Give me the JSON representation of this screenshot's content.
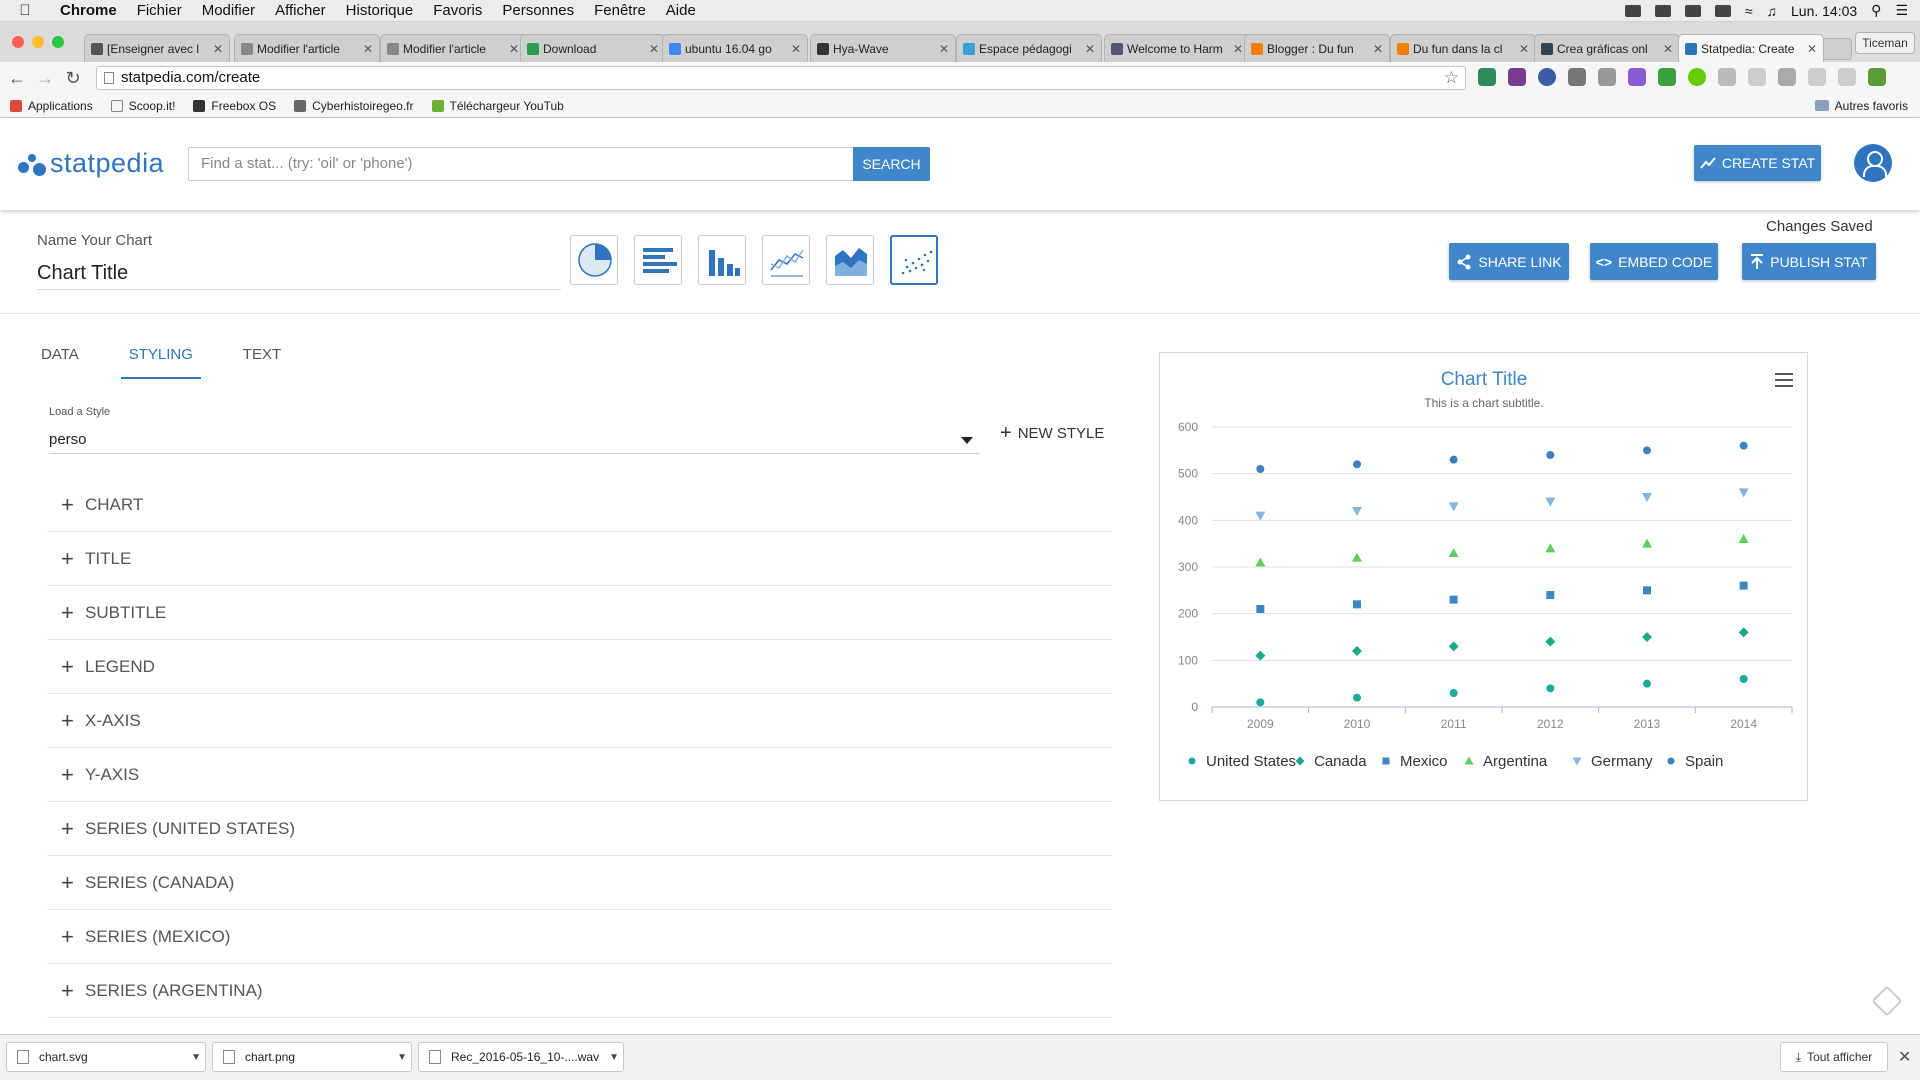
{
  "menubar": {
    "app": "Chrome",
    "items": [
      "Fichier",
      "Modifier",
      "Afficher",
      "Historique",
      "Favoris",
      "Personnes",
      "Fenêtre",
      "Aide"
    ],
    "clock": "Lun. 14:03"
  },
  "browser": {
    "tabs": [
      {
        "label": "[Enseigner avec l",
        "favicon_color": "#555555"
      },
      {
        "label": "Modifier l'article",
        "favicon_color": "#888888"
      },
      {
        "label": "Modifier l'article",
        "favicon_color": "#888888"
      },
      {
        "label": "Download",
        "favicon_color": "#2e9d4f"
      },
      {
        "label": "ubuntu 16.04 go",
        "favicon_color": "#4285f4"
      },
      {
        "label": "Hya-Wave",
        "favicon_color": "#333333"
      },
      {
        "label": "Espace pédagogi",
        "favicon_color": "#3aa0d8"
      },
      {
        "label": "Welcome to Harm",
        "favicon_color": "#555577"
      },
      {
        "label": "Blogger : Du fun",
        "favicon_color": "#f57d00"
      },
      {
        "label": "Du fun dans la cl",
        "favicon_color": "#f57d00"
      },
      {
        "label": "Crea gráficas onl",
        "favicon_color": "#334455"
      },
      {
        "label": "Statpedia: Create",
        "favicon_color": "#2f74c0"
      }
    ],
    "profile": "Ticeman",
    "url": "statpedia.com/create",
    "bookmarks": [
      {
        "label": "Applications",
        "icon": "apps-grid-icon",
        "color": "#d64d3c"
      },
      {
        "label": "Scoop.it!",
        "icon": "page-icon",
        "color": "#888888"
      },
      {
        "label": "Freebox OS",
        "icon": "freebox-icon",
        "color": "#333333"
      },
      {
        "label": "Cyberhistoiregeo.fr",
        "icon": "owl-icon",
        "color": "#666666"
      },
      {
        "label": "Téléchargeur YouTub",
        "icon": "download-icon",
        "color": "#6bb02e"
      }
    ],
    "other_bookmarks": "Autres favoris"
  },
  "site": {
    "logo": "statpedia",
    "search_placeholder": "Find a stat... (try: 'oil' or 'phone')",
    "search_button": "SEARCH",
    "create_stat": "CREATE STAT"
  },
  "editor": {
    "name_label": "Name Your Chart",
    "chart_name": "Chart Title",
    "changes_saved": "Changes Saved",
    "share_link": "SHARE LINK",
    "embed_code": "EMBED CODE",
    "publish_stat": "PUBLISH STAT",
    "tabs": [
      "DATA",
      "STYLING",
      "TEXT"
    ],
    "active_tab": "STYLING",
    "load_style_label": "Load a Style",
    "load_style_value": "perso",
    "new_style": "NEW STYLE",
    "sections": [
      "CHART",
      "TITLE",
      "SUBTITLE",
      "LEGEND",
      "X-AXIS",
      "Y-AXIS",
      "SERIES (UNITED STATES)",
      "SERIES (CANADA)",
      "SERIES (MEXICO)",
      "SERIES (ARGENTINA)"
    ]
  },
  "chart_data": {
    "type": "scatter",
    "title": "Chart Title",
    "subtitle": "This is a chart subtitle.",
    "xlabel": "",
    "ylabel": "",
    "categories": [
      "2009",
      "2010",
      "2011",
      "2012",
      "2013",
      "2014"
    ],
    "ylim": [
      0,
      600
    ],
    "yticks": [
      0,
      100,
      200,
      300,
      400,
      500,
      600
    ],
    "grid": true,
    "legend_position": "bottom",
    "series": [
      {
        "name": "United States",
        "marker": "circle",
        "color": "#1aaaa0",
        "values": [
          10,
          20,
          30,
          40,
          50,
          60
        ]
      },
      {
        "name": "Canada",
        "marker": "diamond",
        "color": "#1aaa88",
        "values": [
          110,
          120,
          130,
          140,
          150,
          160
        ]
      },
      {
        "name": "Mexico",
        "marker": "square",
        "color": "#3d86c6",
        "values": [
          210,
          220,
          230,
          240,
          250,
          260
        ]
      },
      {
        "name": "Argentina",
        "marker": "triangle",
        "color": "#5ccf5c",
        "values": [
          310,
          320,
          330,
          340,
          350,
          360
        ]
      },
      {
        "name": "Germany",
        "marker": "triangle-down",
        "color": "#86b6e0",
        "values": [
          410,
          420,
          430,
          440,
          450,
          460
        ]
      },
      {
        "name": "Spain",
        "marker": "circle",
        "color": "#3f7ec4",
        "values": [
          510,
          520,
          530,
          540,
          550,
          560
        ]
      }
    ]
  },
  "downloads": {
    "items": [
      "chart.svg",
      "chart.png",
      "Rec_2016-05-16_10-....wav"
    ],
    "show_all": "Tout afficher"
  }
}
